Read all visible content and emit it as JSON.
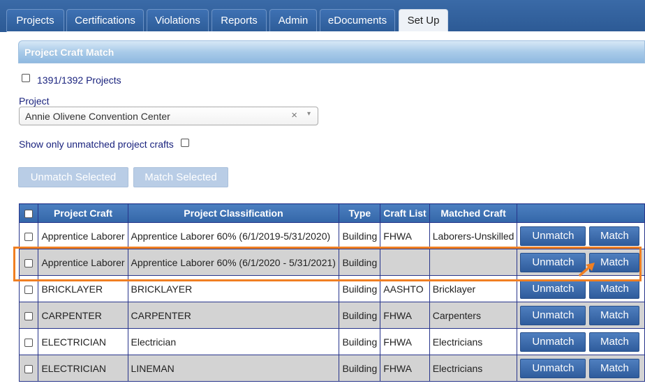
{
  "tabs": [
    {
      "label": "Projects",
      "active": false
    },
    {
      "label": "Certifications",
      "active": false
    },
    {
      "label": "Violations",
      "active": false
    },
    {
      "label": "Reports",
      "active": false
    },
    {
      "label": "Admin",
      "active": false
    },
    {
      "label": "eDocuments",
      "active": false
    },
    {
      "label": "Set Up",
      "active": true
    }
  ],
  "panel": {
    "title": "Project Craft Match",
    "projects_filter_label": "1391/1392 Projects",
    "project_label": "Project",
    "project_select": {
      "value": "Annie Olivene Convention Center",
      "clear_glyph": "×",
      "arrow_glyph": "▾"
    },
    "unmatched_only_label": "Show only unmatched project crafts",
    "unmatch_selected_label": "Unmatch Selected",
    "match_selected_label": "Match Selected"
  },
  "table": {
    "headers": [
      "Project Craft",
      "Project Classification",
      "Type",
      "Craft List",
      "Matched Craft"
    ],
    "unmatch_label": "Unmatch",
    "match_label": "Match",
    "rows": [
      {
        "craft": "Apprentice Laborer",
        "classification": "Apprentice Laborer 60% (6/1/2019-5/31/2020)",
        "type": "Building",
        "craft_list": "FHWA",
        "matched": "Laborers-Unskilled"
      },
      {
        "craft": "Apprentice Laborer",
        "classification": "Apprentice Laborer 60% (6/1/2020 - 5/31/2021)",
        "type": "Building",
        "craft_list": "",
        "matched": ""
      },
      {
        "craft": "BRICKLAYER",
        "classification": "BRICKLAYER",
        "type": "Building",
        "craft_list": "AASHTO",
        "matched": "Bricklayer"
      },
      {
        "craft": "CARPENTER",
        "classification": "CARPENTER",
        "type": "Building",
        "craft_list": "FHWA",
        "matched": "Carpenters"
      },
      {
        "craft": "ELECTRICIAN",
        "classification": "Electrician",
        "type": "Building",
        "craft_list": "FHWA",
        "matched": "Electricians"
      },
      {
        "craft": "ELECTRICIAN",
        "classification": "LINEMAN",
        "type": "Building",
        "craft_list": "FHWA",
        "matched": "Electricians"
      }
    ]
  },
  "colors": {
    "highlight": "#f07f22",
    "header_blue": "#3366a8",
    "alt_row": "#d3d3d3"
  },
  "icons": {
    "cursor": "pointer-arrow-icon",
    "clear": "clear-x-icon",
    "dropdown": "chevron-down-icon"
  }
}
